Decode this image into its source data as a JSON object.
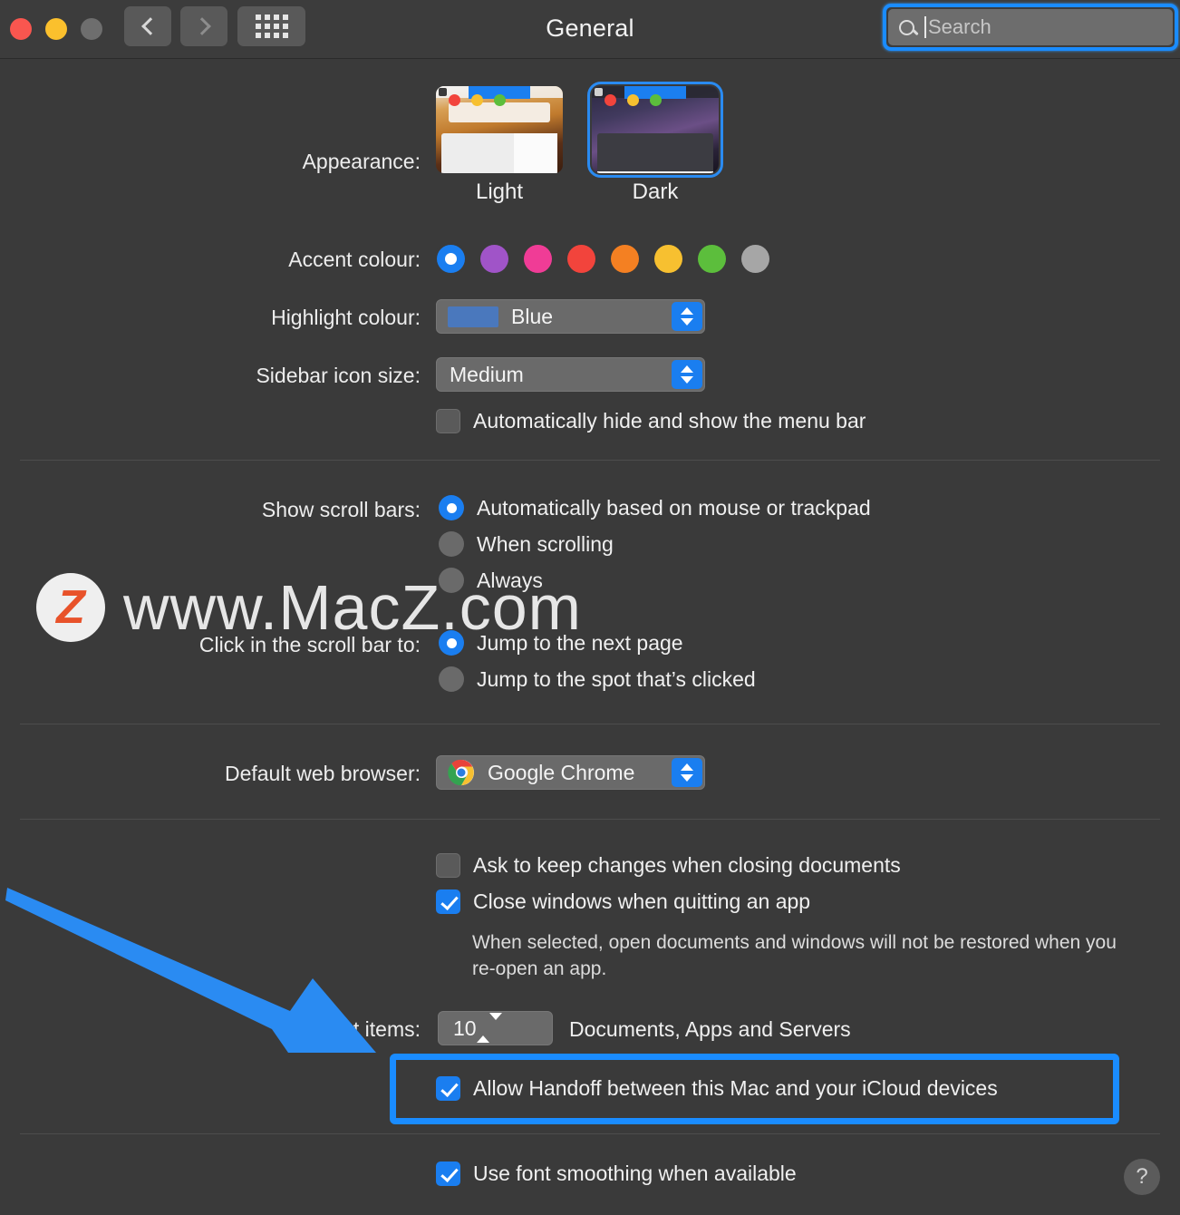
{
  "window": {
    "title": "General",
    "traffic_lights": [
      "close",
      "minimize",
      "zoom"
    ],
    "back_label": "Back",
    "forward_label": "Forward",
    "show_all_label": "Show All"
  },
  "search": {
    "placeholder": "Search",
    "value": "",
    "focused": true,
    "icon": "search-icon"
  },
  "appearance": {
    "label": "Appearance:",
    "options": [
      {
        "id": "light",
        "caption": "Light",
        "selected": false
      },
      {
        "id": "dark",
        "caption": "Dark",
        "selected": true
      }
    ]
  },
  "accent_colour": {
    "label": "Accent colour:",
    "swatches": [
      {
        "name": "blue",
        "hex": "#1a7ef0",
        "selected": true
      },
      {
        "name": "purple",
        "hex": "#a054c8",
        "selected": false
      },
      {
        "name": "pink",
        "hex": "#f03c96",
        "selected": false
      },
      {
        "name": "red",
        "hex": "#f2443c",
        "selected": false
      },
      {
        "name": "orange",
        "hex": "#f48022",
        "selected": false
      },
      {
        "name": "yellow",
        "hex": "#f7c030",
        "selected": false
      },
      {
        "name": "green",
        "hex": "#5cbe3c",
        "selected": false
      },
      {
        "name": "graphite",
        "hex": "#a6a6a6",
        "selected": false
      }
    ]
  },
  "highlight_colour": {
    "label": "Highlight colour:",
    "value": "Blue",
    "swatch_hex": "#4a78bd"
  },
  "sidebar_icon_size": {
    "label": "Sidebar icon size:",
    "value": "Medium"
  },
  "auto_hide_menu_bar": {
    "label": "Automatically hide and show the menu bar",
    "checked": false
  },
  "show_scroll_bars": {
    "label": "Show scroll bars:",
    "options": [
      {
        "label": "Automatically based on mouse or trackpad",
        "selected": true
      },
      {
        "label": "When scrolling",
        "selected": false
      },
      {
        "label": "Always",
        "selected": false
      }
    ]
  },
  "click_scroll_bar": {
    "label": "Click in the scroll bar to:",
    "options": [
      {
        "label": "Jump to the next page",
        "selected": true
      },
      {
        "label": "Jump to the spot that’s clicked",
        "selected": false
      }
    ]
  },
  "default_web_browser": {
    "label": "Default web browser:",
    "value": "Google Chrome",
    "icon": "chrome-icon"
  },
  "documents": {
    "ask_to_keep_changes": {
      "label": "Ask to keep changes when closing documents",
      "checked": false
    },
    "close_windows_quitting": {
      "label": "Close windows when quitting an app",
      "checked": true
    },
    "close_windows_help": "When selected, open documents and windows will not be restored when you re-open an app."
  },
  "recent_items": {
    "label": "Recent items:",
    "value": "10",
    "suffix": "Documents, Apps and Servers"
  },
  "handoff": {
    "label": "Allow Handoff between this Mac and your iCloud devices",
    "checked": true,
    "highlighted": true
  },
  "font_smoothing": {
    "label": "Use font smoothing when available",
    "checked": true
  },
  "help_button": {
    "label": "?"
  },
  "watermark": {
    "badge_letter": "Z",
    "text": "www.MacZ.com"
  },
  "annotations": {
    "arrow_color": "#1a8cff",
    "rect_color": "#1a8cff"
  }
}
